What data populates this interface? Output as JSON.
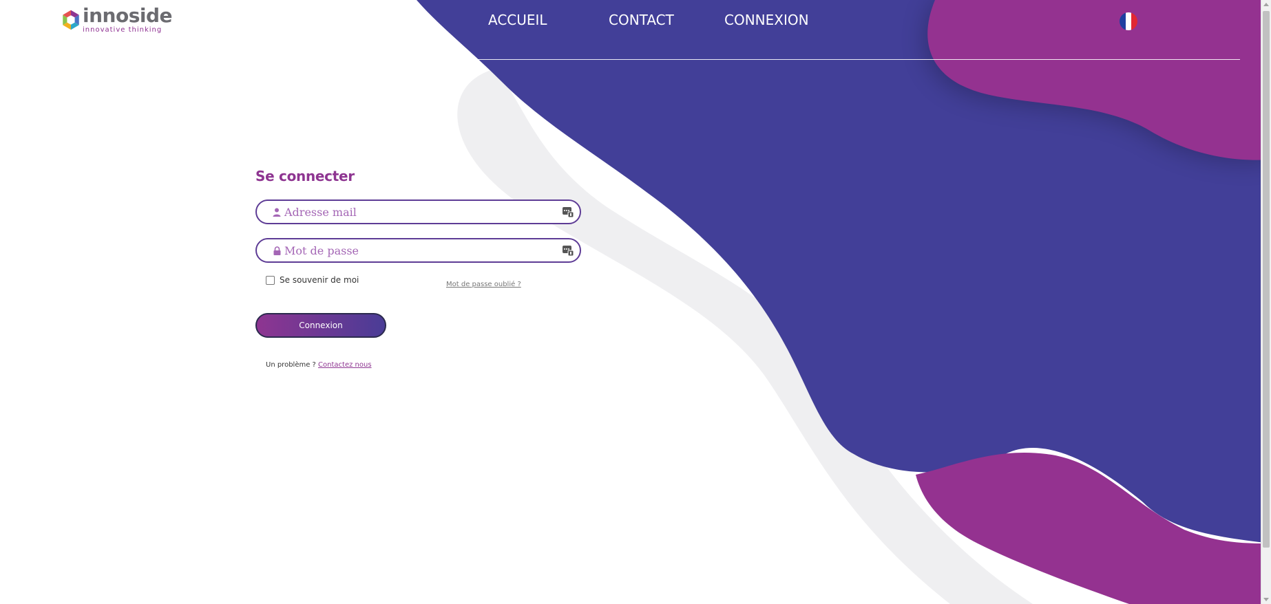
{
  "brand": {
    "name": "innoside",
    "tagline": "innovative thinking"
  },
  "nav": {
    "items": [
      {
        "label": "ACCUEIL"
      },
      {
        "label": "CONTACT"
      },
      {
        "label": "CONNEXION"
      }
    ],
    "language_icon": "france-flag-icon"
  },
  "login": {
    "title": "Se connecter",
    "email_placeholder": "Adresse mail",
    "password_placeholder": "Mot de passe",
    "remember_label": "Se souvenir de moi",
    "forgot_label": "Mot de passe oublié ?",
    "submit_label": "Connexion",
    "help_text": "Un problème ?",
    "help_link": "Contactez nous"
  },
  "colors": {
    "primary_blue": "#423f98",
    "primary_purple": "#943290",
    "accent_text": "#8e3591"
  }
}
